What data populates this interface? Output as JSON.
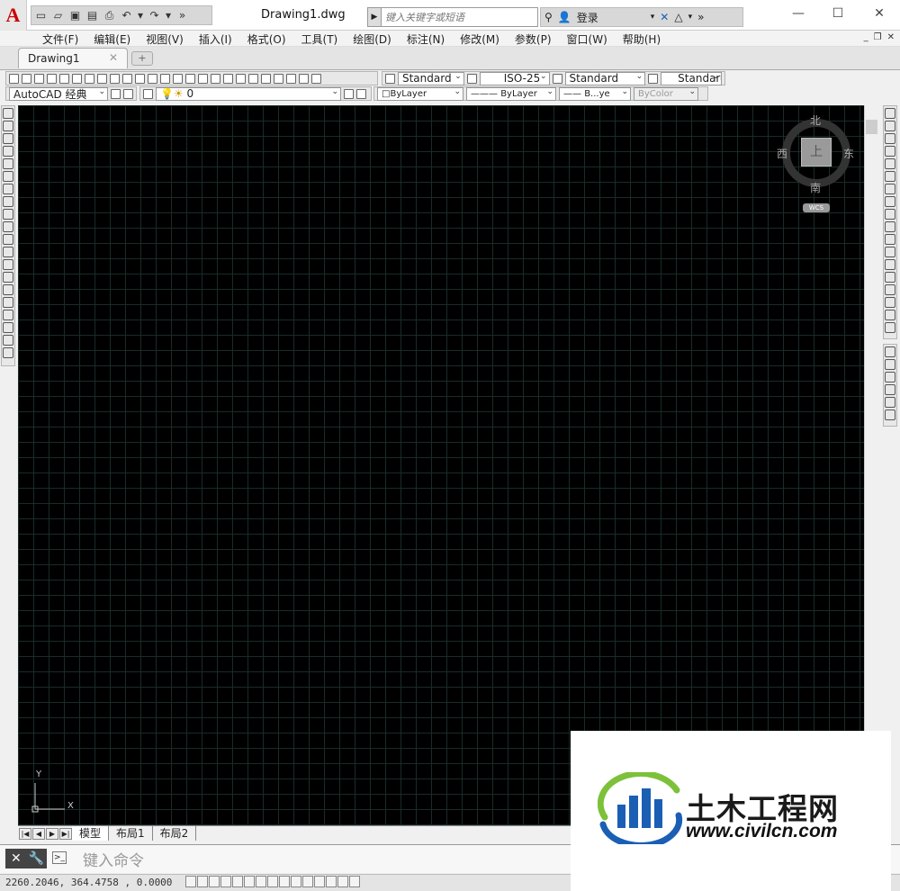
{
  "window": {
    "title": "Drawing1.dwg",
    "search_placeholder": "键入关键字或短语",
    "login": "登录",
    "close_glyph": "✕",
    "max_glyph": "☐",
    "min_glyph": "—"
  },
  "app_logo": "A",
  "menu": [
    "文件(F)",
    "编辑(E)",
    "视图(V)",
    "插入(I)",
    "格式(O)",
    "工具(T)",
    "绘图(D)",
    "标注(N)",
    "修改(M)",
    "参数(P)",
    "窗口(W)",
    "帮助(H)"
  ],
  "doc_tab": {
    "label": "Drawing1",
    "close": "✕",
    "new": "+"
  },
  "styles": {
    "text_style": "Standard",
    "dim_style": "ISO-25",
    "table_style": "Standard",
    "multileader_style": "Standard"
  },
  "workspace": "AutoCAD 经典",
  "layer": {
    "current": "0"
  },
  "properties": {
    "color": "ByLayer",
    "linetype": "ByLayer",
    "lineweight": "B...ye",
    "plotstyle": "ByColor"
  },
  "viewcube": {
    "north": "北",
    "south": "南",
    "east": "东",
    "west": "西",
    "top": "上",
    "wcs": "WCS"
  },
  "ucs": {
    "x": "X",
    "y": "Y"
  },
  "layout_tabs": [
    "模型",
    "布局1",
    "布局2"
  ],
  "command": {
    "placeholder": "键入命令"
  },
  "status": {
    "coords": "2260.2046, 364.4758 , 0.0000"
  },
  "watermark": {
    "title": "土木工程网",
    "url": "www.civilcn.com"
  },
  "colors": {
    "canvas": "#000000",
    "grid": "#1b2a2a",
    "logo_blue": "#1b5fb5",
    "logo_green": "#7dc13a"
  }
}
